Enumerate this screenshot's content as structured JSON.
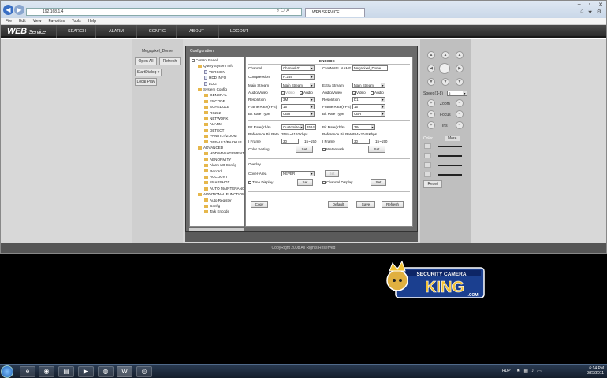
{
  "browser": {
    "address": "192.168.1.4",
    "tab_title": "WEB SERVICE",
    "menu": [
      "File",
      "Edit",
      "View",
      "Favorites",
      "Tools",
      "Help"
    ]
  },
  "app": {
    "logo_main": "WEB",
    "logo_sub": "Service",
    "nav": [
      "SEARCH",
      "ALARM",
      "CONFIG",
      "ABOUT",
      "LOGOUT"
    ]
  },
  "left": {
    "device": "Megapixel_Dome",
    "open_all": "Open All",
    "refresh": "Refresh",
    "start_dialog": "StartDialog",
    "local_play": "Local Play"
  },
  "dialog": {
    "title": "Configuration",
    "tree": [
      {
        "label": "Control Panel",
        "level": 0,
        "type": "root"
      },
      {
        "label": "Query System Info",
        "level": 1,
        "type": "folder"
      },
      {
        "label": "VERSION",
        "level": 2,
        "type": "doc"
      },
      {
        "label": "HDD INFO",
        "level": 2,
        "type": "doc"
      },
      {
        "label": "LOG",
        "level": 2,
        "type": "doc"
      },
      {
        "label": "System Config",
        "level": 1,
        "type": "folder"
      },
      {
        "label": "GENERAL",
        "level": 2,
        "type": "folder"
      },
      {
        "label": "ENCODE",
        "level": 2,
        "type": "folder"
      },
      {
        "label": "SCHEDULE",
        "level": 2,
        "type": "folder"
      },
      {
        "label": "RS232",
        "level": 2,
        "type": "folder"
      },
      {
        "label": "NETWORK",
        "level": 2,
        "type": "folder"
      },
      {
        "label": "ALARM",
        "level": 2,
        "type": "folder"
      },
      {
        "label": "DETECT",
        "level": 2,
        "type": "folder"
      },
      {
        "label": "PAN/TILT/ZOOM",
        "level": 2,
        "type": "folder"
      },
      {
        "label": "DEFAULT/BACKUP",
        "level": 2,
        "type": "folder"
      },
      {
        "label": "ADVANCED",
        "level": 1,
        "type": "folder"
      },
      {
        "label": "HDD MANAGEMENT",
        "level": 2,
        "type": "folder"
      },
      {
        "label": "ABNORMITY",
        "level": 2,
        "type": "folder"
      },
      {
        "label": "Alarm I/O Config",
        "level": 2,
        "type": "folder"
      },
      {
        "label": "Record",
        "level": 2,
        "type": "folder"
      },
      {
        "label": "ACCOUNT",
        "level": 2,
        "type": "folder"
      },
      {
        "label": "SNAPSHOT",
        "level": 2,
        "type": "folder"
      },
      {
        "label": "AUTO MAINTENANCE",
        "level": 2,
        "type": "folder"
      },
      {
        "label": "ADDITIONAL FUNCTION",
        "level": 1,
        "type": "folder"
      },
      {
        "label": "Auto Register",
        "level": 2,
        "type": "folder"
      },
      {
        "label": "Config",
        "level": 2,
        "type": "folder"
      },
      {
        "label": "Talk Encode",
        "level": 2,
        "type": "folder"
      }
    ],
    "encode_heading": "ENCODE",
    "left": {
      "channel_label": "Channel",
      "channel": "Channel 01",
      "compression_label": "Compression",
      "compression": "H.264",
      "main_stream_label": "Main Stream",
      "main_stream": "Main Stream",
      "av_label": "Audio/Video",
      "video": "Video",
      "audio": "Audio",
      "resolution_label": "Resolution",
      "resolution": "3M",
      "framerate_label": "Frame Rate(FPS)",
      "framerate": "15",
      "bitrate_type_label": "Bit Rate Type",
      "bitrate_type": "CBR",
      "bitrate_label": "Bit Rate(Kb/s)",
      "bitrate_mode": "Customize",
      "bitrate_value": "3584",
      "ref_label": "Reference Bit Rate",
      "ref_value": "3584~8192Kbps",
      "iframe_label": "I Frame",
      "iframe": "30",
      "iframe_range": "15~150",
      "color_label": "Color Setting",
      "set": "Set"
    },
    "right": {
      "name_label": "CHANNEL NAME",
      "name": "Megapixel_Dome",
      "extra_label": "Extra Stream",
      "extra": "Main Stream",
      "av_label": "Audio/Video",
      "video": "Video",
      "audio": "Audio",
      "resolution_label": "Resolution",
      "resolution": "D1",
      "framerate_label": "Frame Rate(FPS)",
      "framerate": "15",
      "bitrate_type_label": "Bit Rate Type",
      "bitrate_type": "CBR",
      "bitrate_label": "Bit Rate(Kb/s)",
      "bitrate_value": "384",
      "ref_label": "Reference Bit Rate",
      "ref_value": "384~2048Kbps",
      "iframe_label": "I Frame",
      "iframe": "30",
      "iframe_range": "15~150",
      "watermark": "Watermark",
      "set": "Set"
    },
    "overlay": {
      "heading": "Overlay",
      "cover_label": "Cover-Area",
      "cover": "NEVER",
      "set": "Set",
      "time_display": "Time Display",
      "channel_display": "Channel Display"
    },
    "buttons": {
      "copy": "Copy",
      "default": "Default",
      "save": "Save",
      "refresh": "Refresh"
    }
  },
  "ptz": {
    "speed_label": "Speed(1-8)",
    "speed": "5",
    "zoom": "Zoom",
    "focus": "Focus",
    "iris": "Iris",
    "color_tab": "Color",
    "more_tab": "More",
    "reset": "Reset"
  },
  "footer": "CopyRight 2008 All Rights Reserved",
  "watermark_logo": {
    "top": "SECURITY CAMERA",
    "main": "KING",
    "sub": ".COM"
  },
  "taskbar": {
    "rdp": "RDP",
    "time": "6:14 PM",
    "date": "8/25/2011"
  },
  "colors": {
    "appbar": "#2d2d2d",
    "dialog": "#6a6a6a",
    "accent": "#1d5fb3"
  }
}
